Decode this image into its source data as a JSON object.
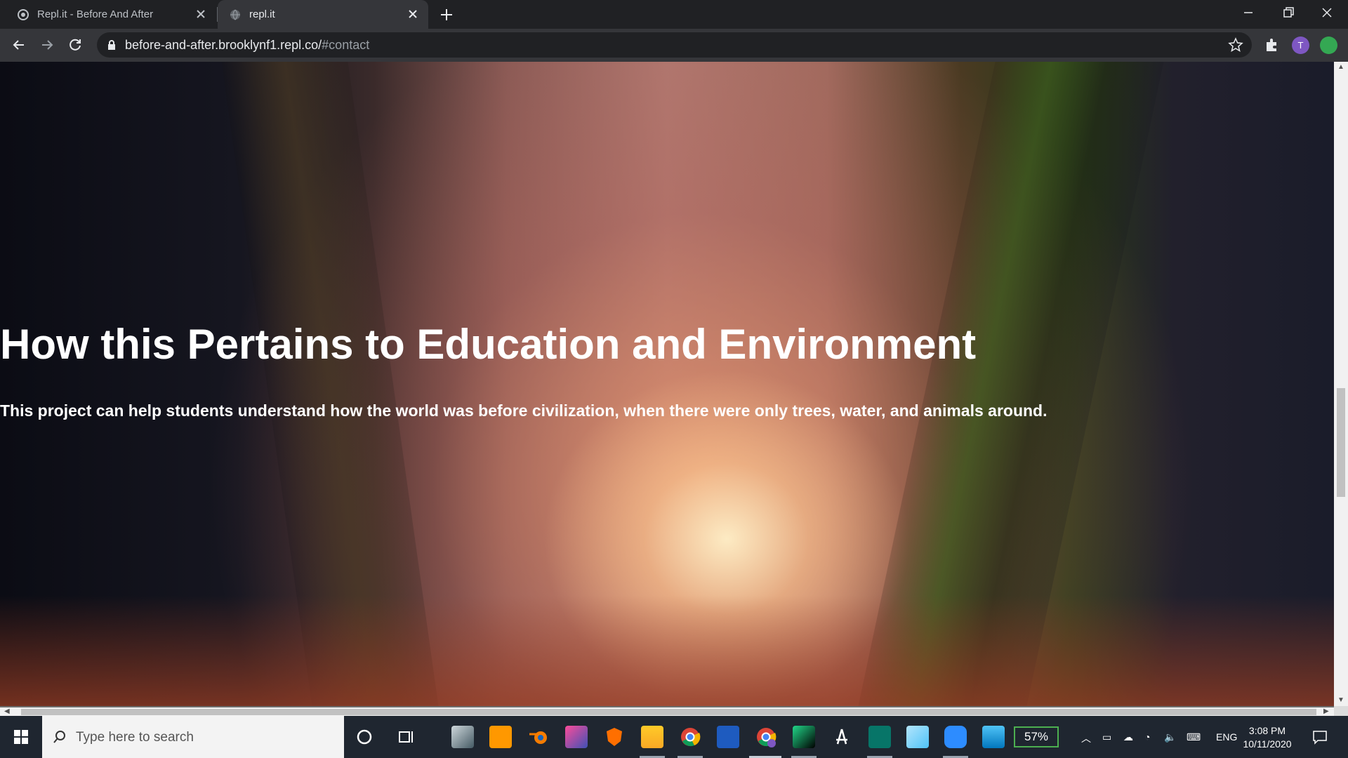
{
  "browser": {
    "tabs": [
      {
        "title": "Repl.it - Before And After",
        "active": false
      },
      {
        "title": "repl.it",
        "active": true
      }
    ],
    "url_host": "before-and-after.brooklynf1.repl.co/",
    "url_path": "#contact",
    "profile_initial": "T"
  },
  "page": {
    "heading": "How this Pertains to Education and Environment",
    "paragraph": "This project can help students understand how the world was before civilization, when there were only trees, water, and animals around."
  },
  "taskbar": {
    "search_placeholder": "Type here to search",
    "battery": "57%",
    "language": "ENG",
    "time": "3:08 PM",
    "date": "10/11/2020",
    "apps": [
      "cortana-icon",
      "task-view-icon",
      "ink-app-icon",
      "sublime-text-icon",
      "blender-icon",
      "intellij-icon",
      "brave-icon",
      "file-explorer-icon",
      "chrome-icon",
      "word-icon",
      "chrome-profile-icon",
      "pycharm-icon",
      "acrobat-icon",
      "publisher-icon",
      "notes-icon",
      "zoom-icon",
      "photos-icon"
    ]
  }
}
